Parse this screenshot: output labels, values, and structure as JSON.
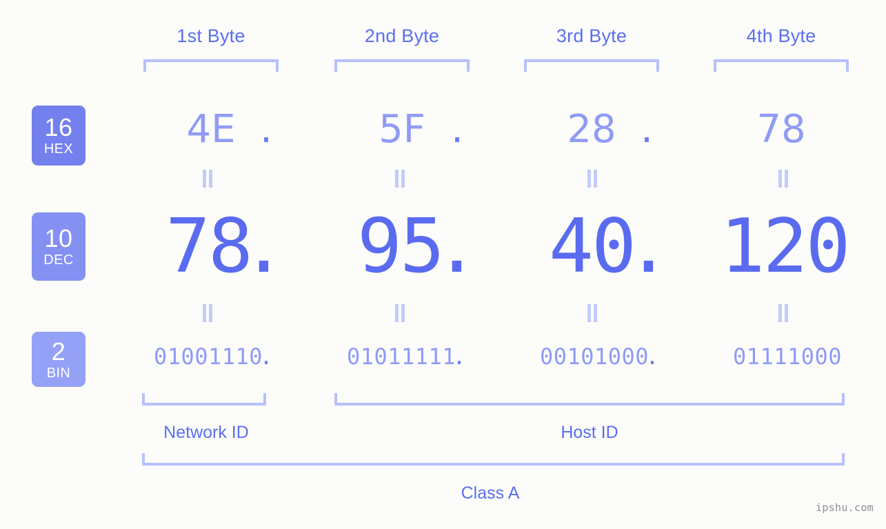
{
  "meta": {
    "watermark": "ipshu.com",
    "background_color": "#fcfdfa",
    "accent_color": "#5b6ef0",
    "bracket_color": "#b6c0fb"
  },
  "byte_headers": [
    {
      "label": "1st Byte"
    },
    {
      "label": "2nd Byte"
    },
    {
      "label": "3rd Byte"
    },
    {
      "label": "4th Byte"
    }
  ],
  "bases": [
    {
      "number": "16",
      "name": "HEX",
      "color": "#7480ed"
    },
    {
      "number": "10",
      "name": "DEC",
      "color": "#8490f2"
    },
    {
      "number": "2",
      "name": "BIN",
      "color": "#94a1f7"
    }
  ],
  "separator_dot": ".",
  "rows": {
    "hex": {
      "base_number": "16",
      "base_name": "HEX",
      "values": [
        "4E",
        "5F",
        "28",
        "78"
      ]
    },
    "dec": {
      "base_number": "10",
      "base_name": "DEC",
      "values": [
        "78",
        "95",
        "40",
        "120"
      ]
    },
    "bin": {
      "base_number": "2",
      "base_name": "BIN",
      "values": [
        "01001110",
        "01011111",
        "00101000",
        "01111000"
      ]
    }
  },
  "sections": {
    "network_id": "Network ID",
    "host_id": "Host ID",
    "class": "Class A"
  }
}
